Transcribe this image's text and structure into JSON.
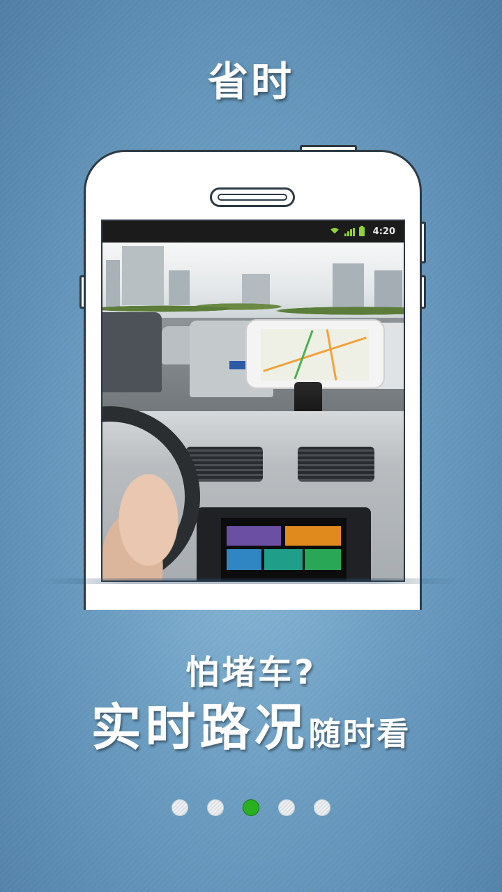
{
  "headline": "省时",
  "phone_status": {
    "time": "4:20"
  },
  "tagline": {
    "line1": "怕堵车?",
    "line2_big": "实时路况",
    "line2_small": "随时看"
  },
  "pagination": {
    "total": 5,
    "active_index": 2
  },
  "colors": {
    "accent_active_dot": "#29b01e",
    "background": "#6a9cc0"
  }
}
